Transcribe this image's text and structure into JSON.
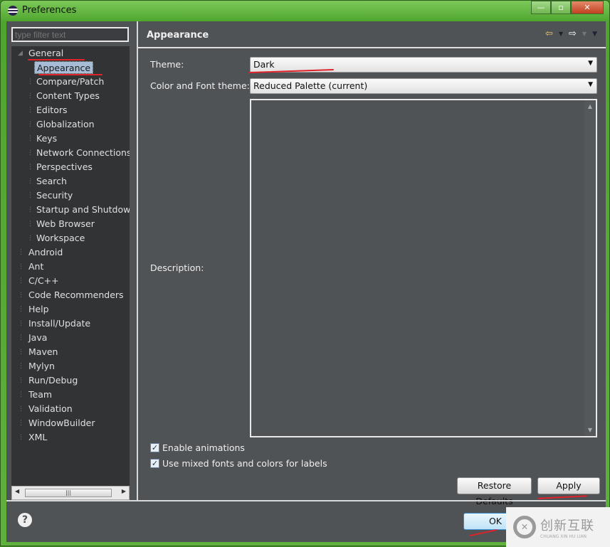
{
  "window": {
    "title": "Preferences",
    "minimize": "—",
    "maximize": "▫",
    "close": "✕"
  },
  "sidebar": {
    "filter_placeholder": "type filter text",
    "items": [
      {
        "label": "General",
        "level": 0,
        "expanded": true
      },
      {
        "label": "Appearance",
        "level": 1,
        "selected": true
      },
      {
        "label": "Compare/Patch",
        "level": 1
      },
      {
        "label": "Content Types",
        "level": 1
      },
      {
        "label": "Editors",
        "level": 1
      },
      {
        "label": "Globalization",
        "level": 1
      },
      {
        "label": "Keys",
        "level": 1
      },
      {
        "label": "Network Connections",
        "level": 1
      },
      {
        "label": "Perspectives",
        "level": 1
      },
      {
        "label": "Search",
        "level": 1
      },
      {
        "label": "Security",
        "level": 1
      },
      {
        "label": "Startup and Shutdown",
        "level": 1
      },
      {
        "label": "Web Browser",
        "level": 1
      },
      {
        "label": "Workspace",
        "level": 1
      },
      {
        "label": "Android",
        "level": 0
      },
      {
        "label": "Ant",
        "level": 0
      },
      {
        "label": "C/C++",
        "level": 0
      },
      {
        "label": "Code Recommenders",
        "level": 0
      },
      {
        "label": "Help",
        "level": 0
      },
      {
        "label": "Install/Update",
        "level": 0
      },
      {
        "label": "Java",
        "level": 0
      },
      {
        "label": "Maven",
        "level": 0
      },
      {
        "label": "Mylyn",
        "level": 0
      },
      {
        "label": "Run/Debug",
        "level": 0
      },
      {
        "label": "Team",
        "level": 0
      },
      {
        "label": "Validation",
        "level": 0
      },
      {
        "label": "WindowBuilder",
        "level": 0
      },
      {
        "label": "XML",
        "level": 0
      }
    ]
  },
  "main": {
    "title": "Appearance",
    "theme_label": "Theme:",
    "theme_value": "Dark",
    "color_font_label": "Color and Font theme:",
    "color_font_value": "Reduced Palette (current)",
    "description_label": "Description:",
    "enable_animations": {
      "label": "Enable animations",
      "checked": true
    },
    "mixed_fonts": {
      "label": "Use mixed fonts and colors for labels",
      "checked": true
    },
    "restore_defaults": "Restore Defaults",
    "apply": "Apply"
  },
  "footer": {
    "ok": "OK",
    "help": "?"
  },
  "watermark": {
    "text": "创新互联",
    "sub": "CHUANG XIN HU LIAN"
  }
}
